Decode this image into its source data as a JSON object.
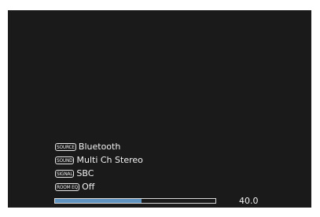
{
  "status": {
    "source": {
      "tag": "SOURCE",
      "value": "Bluetooth"
    },
    "sound": {
      "tag": "SOUND",
      "value": "Multi Ch Stereo"
    },
    "signal": {
      "tag": "SIGNAL",
      "value": "SBC"
    },
    "room_eq": {
      "tag": "ROOM EQ",
      "value": "Off"
    }
  },
  "volume": {
    "value_label": "40.0",
    "level_fraction": 0.54,
    "fill_color": "#5f95c0"
  },
  "colors": {
    "screen_background": "#1a1a1a",
    "text": "#f2f2f2"
  }
}
